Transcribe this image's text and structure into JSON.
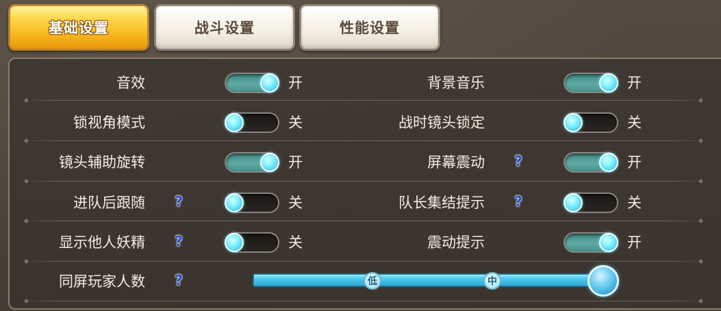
{
  "tabs": [
    {
      "label": "基础设置",
      "active": true
    },
    {
      "label": "战斗设置",
      "active": false
    },
    {
      "label": "性能设置",
      "active": false
    }
  ],
  "settings": {
    "sound_effects": {
      "label": "音效",
      "state": "开",
      "on": true
    },
    "bg_music": {
      "label": "背景音乐",
      "state": "开",
      "on": true
    },
    "lock_view": {
      "label": "锁视角模式",
      "state": "关",
      "on": false
    },
    "battle_camera_lock": {
      "label": "战时镜头锁定",
      "state": "关",
      "on": false
    },
    "camera_assist_rotate": {
      "label": "镜头辅助旋转",
      "state": "开",
      "on": true
    },
    "screen_shake": {
      "label": "屏幕震动",
      "state": "开",
      "on": true,
      "help": "?"
    },
    "follow_after_join": {
      "label": "进队后跟随",
      "state": "关",
      "on": false,
      "help": "?"
    },
    "leader_gather_hint": {
      "label": "队长集结提示",
      "state": "关",
      "on": false,
      "help": "?"
    },
    "show_others_fairy": {
      "label": "显示他人妖精",
      "state": "关",
      "on": false,
      "help": "?"
    },
    "vibration_hint": {
      "label": "震动提示",
      "state": "开",
      "on": true
    }
  },
  "player_count": {
    "label": "同屏玩家人数",
    "help": "?",
    "ticks": [
      "低",
      "中"
    ],
    "level": "high"
  },
  "colors": {
    "tab_active": "#f7b41c",
    "toggle_on": "#5fa8a2",
    "toggle_off": "#1a1714",
    "knob": "#8cf4ff",
    "help_icon": "#1f4fd0"
  }
}
